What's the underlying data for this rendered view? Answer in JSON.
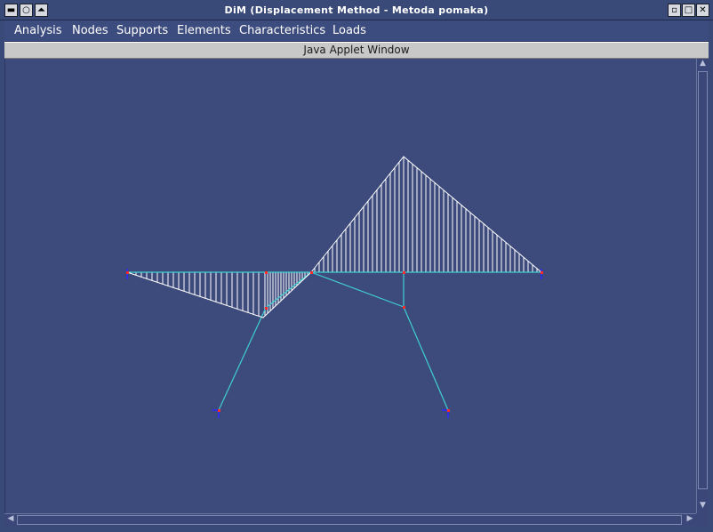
{
  "window": {
    "title": "DiM (Displacement Method - Metoda pomaka)",
    "left_buttons": [
      "minimize-icon",
      "circle-icon",
      "shade-icon"
    ],
    "right_buttons": [
      "restore-icon",
      "maximize-icon",
      "close-icon"
    ]
  },
  "menu": {
    "items": [
      {
        "label": "Analysis"
      },
      {
        "label": "Nodes"
      },
      {
        "label": "Supports"
      },
      {
        "label": "Elements"
      },
      {
        "label": "Characteristics"
      },
      {
        "label": "Loads"
      }
    ]
  },
  "applet": {
    "banner": "Java Applet Window"
  },
  "colors": {
    "canvas_bg": "#3c4a7c",
    "frame_line": "#3fd0d0",
    "diagram_line": "#ffffff",
    "node": "#ff2020",
    "support": "#2020ff"
  }
}
